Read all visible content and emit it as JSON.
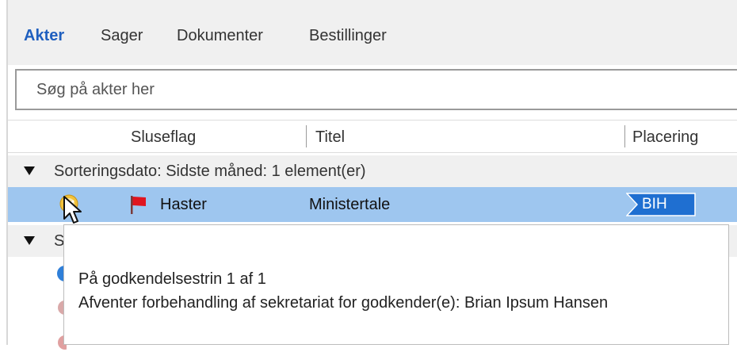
{
  "nav": {
    "tabs": [
      {
        "label": "Akter",
        "active": true
      },
      {
        "label": "Sager",
        "active": false
      },
      {
        "label": "Dokumenter",
        "active": false
      },
      {
        "label": "Bestillinger",
        "active": false
      }
    ]
  },
  "search": {
    "placeholder": "Søg på akter her",
    "value": ""
  },
  "columns": {
    "sluseflag": "Sluseflag",
    "titel": "Titel",
    "placering": "Placering"
  },
  "groups": [
    {
      "label": "Sorteringsdato: Sidste måned: 1 element(er)",
      "expanded": true
    },
    {
      "label": "S",
      "expanded": true
    }
  ],
  "rows": [
    {
      "status_icon": "approval-status-icon",
      "flag_icon": "red-flag-icon",
      "sluseflag": "Haster",
      "titel": "Ministertale",
      "placering": "BIH",
      "selected": true
    }
  ],
  "tooltip": {
    "line1": "På godkendelsestrin 1 af 1",
    "line2": "Afventer forbehandling af sekretariat for godkender(e): Brian Ipsum Hansen"
  },
  "colors": {
    "accent": "#1f5fbf",
    "selection": "#9ec6ef",
    "flag": "#e0141e",
    "badge": "#1f6fd1"
  }
}
